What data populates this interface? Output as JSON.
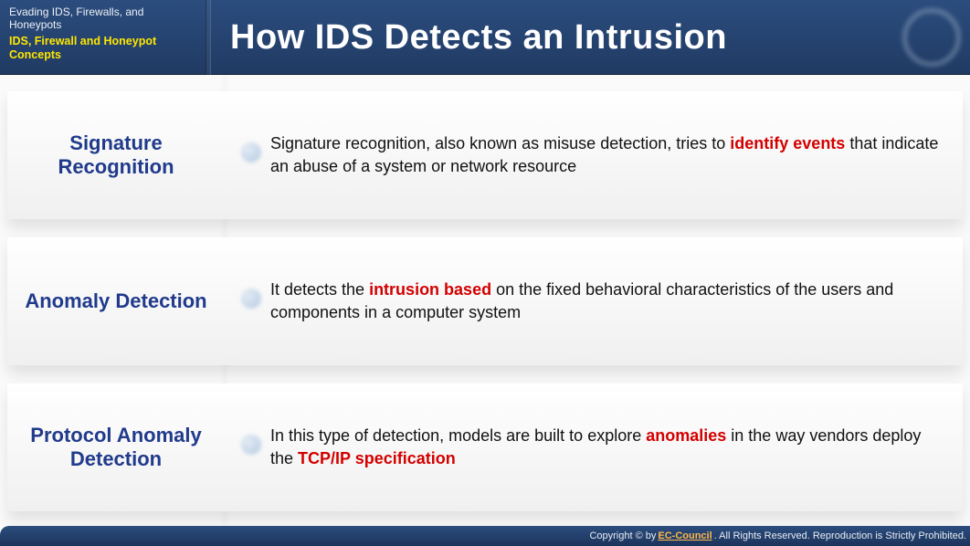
{
  "header": {
    "breadcrumb_top": "Evading IDS, Firewalls, and Honeypots",
    "breadcrumb_current": "IDS, Firewall and Honeypot Concepts",
    "title": "How IDS Detects an Intrusion"
  },
  "rows": [
    {
      "title": "Signature Recognition",
      "desc_pre": "Signature recognition, also known as misuse detection, tries to ",
      "desc_hl": "identify events",
      "desc_post": " that indicate an abuse of a system or network resource"
    },
    {
      "title": "Anomaly Detection",
      "desc_pre": "It detects the ",
      "desc_hl": "intrusion based",
      "desc_post": " on the fixed behavioral characteristics of the users and components in a computer system"
    },
    {
      "title": "Protocol Anomaly Detection",
      "desc_pre": "In this type of detection, models are built to explore ",
      "desc_hl": "anomalies",
      "desc_mid": " in the way vendors deploy the ",
      "desc_hl2": "TCP/IP specification",
      "desc_post": ""
    }
  ],
  "footer": {
    "left": "Copyright © by ",
    "brand": "EC-Council",
    "right": ". All Rights Reserved. Reproduction is Strictly Prohibited."
  }
}
